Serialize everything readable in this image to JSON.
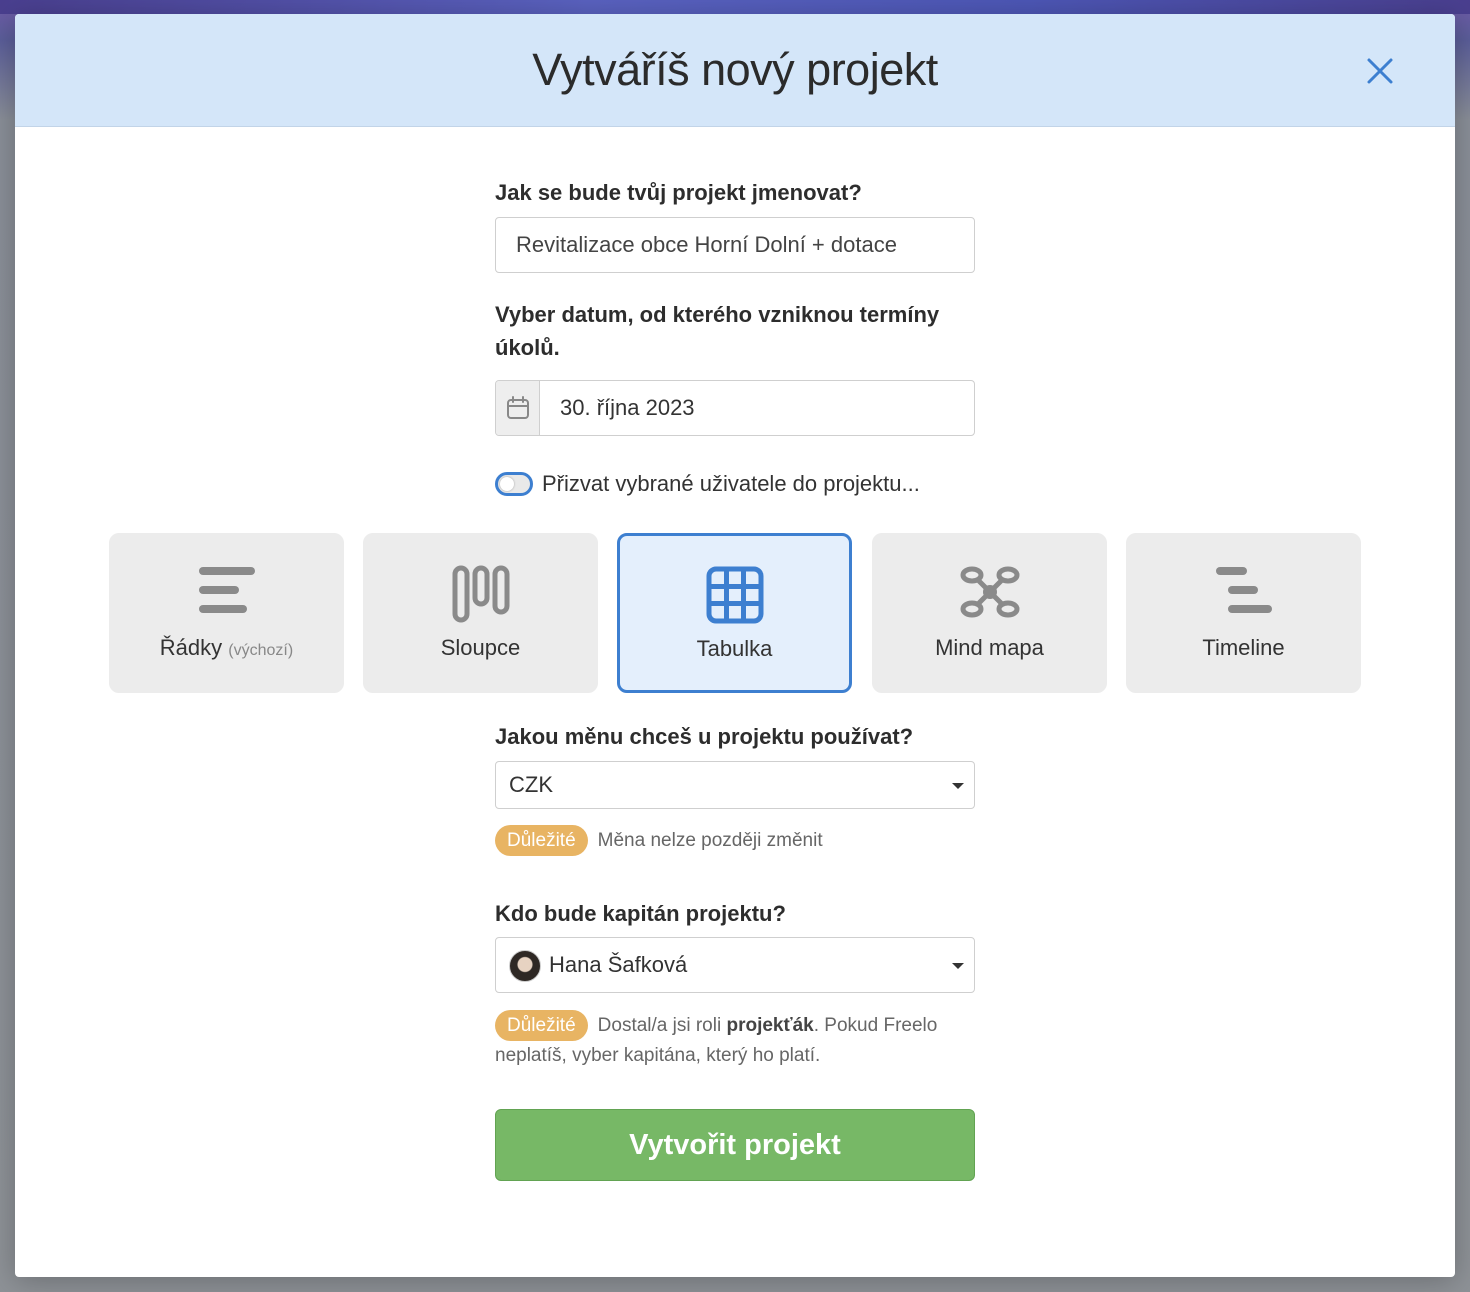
{
  "modal": {
    "title": "Vytváříš nový projekt"
  },
  "name_field": {
    "label": "Jak se bude tvůj projekt jmenovat?",
    "value": "Revitalizace obce Horní Dolní + dotace"
  },
  "date_field": {
    "label": "Vyber datum, od kterého vzniknou termíny úkolů.",
    "value": "30. října 2023",
    "icon": "calendar-icon"
  },
  "invite_toggle": {
    "label": "Přizvat vybrané uživatele do projektu...",
    "checked": false
  },
  "views": [
    {
      "label": "Řádky",
      "hint": "(výchozí)",
      "icon": "rows-icon",
      "selected": false
    },
    {
      "label": "Sloupce",
      "hint": "",
      "icon": "columns-icon",
      "selected": false
    },
    {
      "label": "Tabulka",
      "hint": "",
      "icon": "table-icon",
      "selected": true
    },
    {
      "label": "Mind mapa",
      "hint": "",
      "icon": "mindmap-icon",
      "selected": false
    },
    {
      "label": "Timeline",
      "hint": "",
      "icon": "timeline-icon",
      "selected": false
    }
  ],
  "currency": {
    "label": "Jakou měnu chceš u projektu používat?",
    "value": "CZK",
    "badge": "Důležité",
    "note": "Měna nelze později změnit"
  },
  "captain": {
    "label": "Kdo bude kapitán projektu?",
    "value": "Hana Šafková",
    "badge": "Důležité",
    "note_before": "Dostal/a jsi roli ",
    "note_bold": "projekťák",
    "note_after": ". Pokud Freelo neplatíš, vyber kapitána, který ho platí."
  },
  "submit_label": "Vytvořit projekt",
  "colors": {
    "header_bg": "#d4e6f9",
    "accent": "#3d7fd0",
    "badge": "#e8b463",
    "submit": "#77b866"
  }
}
